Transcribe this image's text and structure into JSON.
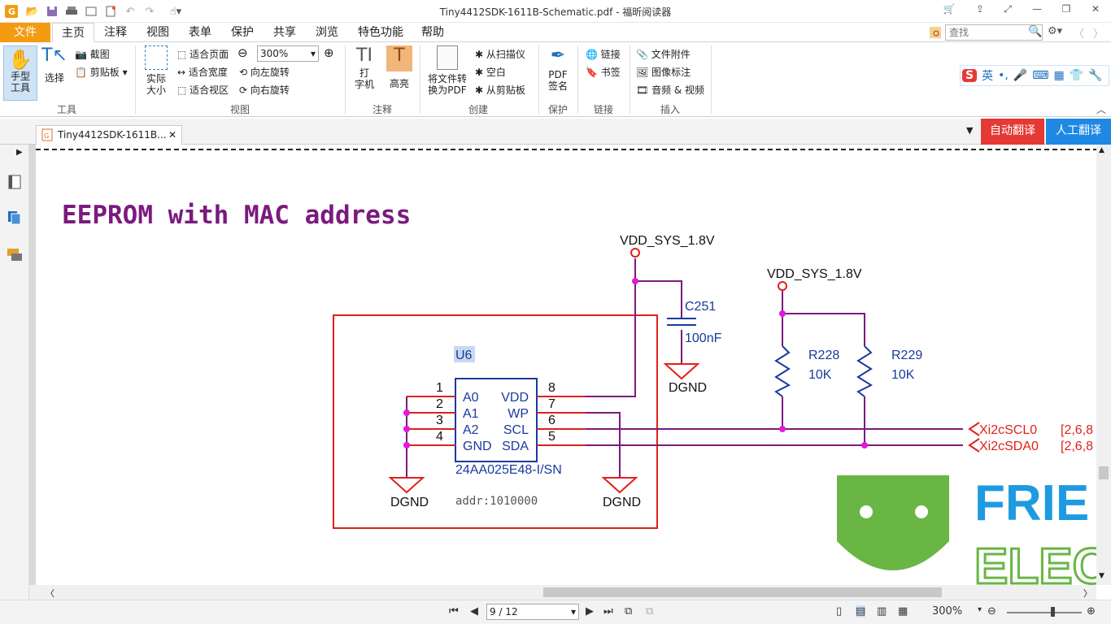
{
  "window": {
    "title": "Tiny4412SDK-1611B-Schematic.pdf - 福昕阅读器"
  },
  "menu": {
    "file": "文件",
    "items": [
      "主页",
      "注释",
      "视图",
      "表单",
      "保护",
      "共享",
      "浏览",
      "特色功能",
      "帮助"
    ]
  },
  "search": {
    "placeholder": "查找"
  },
  "ribbon": {
    "hand": "手型\n工具",
    "select": "选择",
    "screenshot": "截图",
    "clipboard": "剪贴板",
    "group_tools": "工具",
    "actual": "实际\n大小",
    "fit_page": "适合页面",
    "fit_width": "适合宽度",
    "fit_view": "适合视区",
    "zoom": "300%",
    "rot_left": "向左旋转",
    "rot_right": "向右旋转",
    "group_view": "视图",
    "typewriter": "打\n字机",
    "highlight": "高亮",
    "group_comment": "注释",
    "convert": "将文件转\n换为PDF",
    "from_scanner": "从扫描仪",
    "blank": "空白",
    "from_clipboard": "从剪贴板",
    "group_create": "创建",
    "sign": "PDF\n签名",
    "group_protect": "保护",
    "link": "链接",
    "bookmark": "书签",
    "group_link": "链接",
    "attach": "文件附件",
    "image_ann": "图像标注",
    "av": "音频 & 视频",
    "group_insert": "插入"
  },
  "ime": {
    "label": "英"
  },
  "doc_tab": {
    "title": "Tiny4412SDK-1611B..."
  },
  "translate": {
    "auto": "自动翻译",
    "manual": "人工翻译",
    "auto_color": "#e53935",
    "manual_color": "#1e88e5"
  },
  "schematic": {
    "heading": "EEPROM with MAC address",
    "vdd1": "VDD_SYS_1.8V",
    "vdd2": "VDD_SYS_1.8V",
    "c_ref": "C251",
    "c_val": "100nF",
    "r1_ref": "R228",
    "r1_val": "10K",
    "r2_ref": "R229",
    "r2_val": "10K",
    "gnd": "DGND",
    "u_ref": "U6",
    "u_part": "24AA025E48-I/SN",
    "addr": "addr:1010000",
    "pins_left": [
      "A0",
      "A1",
      "A2",
      "GND"
    ],
    "pins_right": [
      "VDD",
      "WP",
      "SCL",
      "SDA"
    ],
    "pnum_left": [
      "1",
      "2",
      "3",
      "4"
    ],
    "pnum_right": [
      "8",
      "7",
      "6",
      "5"
    ],
    "net_scl": "Xi2cSCL0",
    "net_sda": "Xi2cSDA0",
    "ref_scl": "[2,6,8",
    "ref_sda": "[2,6,8",
    "logo_top": "FRIE",
    "logo_bot": "ELEC",
    "colors": {
      "heading": "#7b1a7e",
      "wire": "#7b1a7e",
      "pin": "#e0201a",
      "text": "#1a3a9e",
      "node": "#e01ad6",
      "box": "#e0201a",
      "logo_green": "#69b644",
      "logo_blue": "#1e9be0"
    }
  },
  "status": {
    "page": "9 / 12",
    "zoom": "300%"
  }
}
